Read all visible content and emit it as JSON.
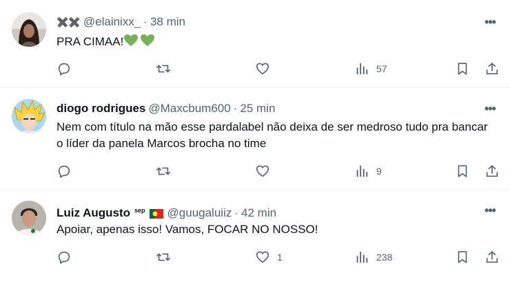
{
  "posts": [
    {
      "name": "",
      "name_emoji": "✖️✖️",
      "handle": "@elainixx_",
      "dot": "·",
      "time": "38 min",
      "text": "PRA CIMAA!",
      "text_emoji": "💚💚",
      "replies": "",
      "reposts": "",
      "likes": "",
      "views": "57"
    },
    {
      "name": "diogo rodrigues",
      "handle": "@Maxcbum600",
      "dot": "·",
      "time": "25 min",
      "text": "Nem com título na mão esse pardalabel não deixa de ser medroso tudo pra bancar o líder da panela Marcos brocha no time",
      "replies": "",
      "reposts": "",
      "likes": "",
      "views": "9"
    },
    {
      "name": "Luiz Augusto",
      "name_suffix": "sep",
      "flag": "portugal-flag",
      "handle": "@guugaluiiz",
      "dot": "·",
      "time": "42 min",
      "text": "Apoiar, apenas isso! Vamos, FOCAR NO NOSSO!",
      "replies": "",
      "reposts": "",
      "likes": "1",
      "views": "238"
    }
  ],
  "more_glyph": "•••",
  "icons": [
    "reply-icon",
    "repost-icon",
    "like-icon",
    "views-icon",
    "bookmark-icon",
    "share-icon",
    "more-icon"
  ],
  "colors": {
    "text": "#0f1419",
    "muted": "#536471",
    "divider": "#eff3f4",
    "heart": "#78b159"
  }
}
